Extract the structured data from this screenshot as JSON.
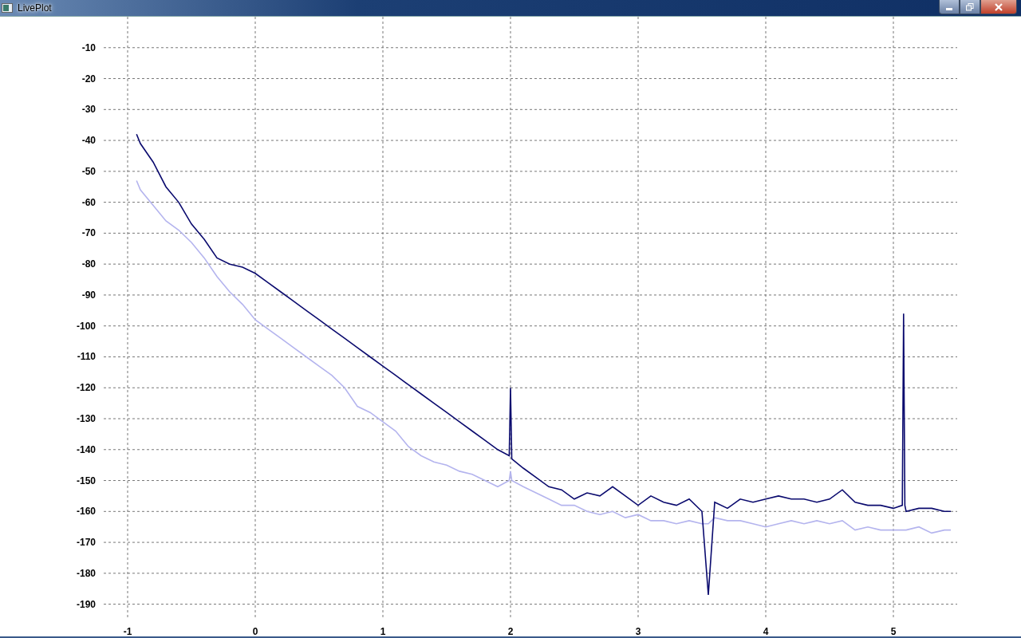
{
  "window": {
    "title": "LivePlot"
  },
  "plot": {
    "chart_data": {
      "type": "line",
      "x": [
        -0.93,
        -0.9,
        -0.8,
        -0.7,
        -0.6,
        -0.5,
        -0.4,
        -0.3,
        -0.2,
        -0.1,
        0,
        0.1,
        0.2,
        0.3,
        0.4,
        0.5,
        0.6,
        0.7,
        0.8,
        0.9,
        1.0,
        1.1,
        1.2,
        1.3,
        1.4,
        1.5,
        1.6,
        1.7,
        1.8,
        1.9,
        1.99,
        2.0,
        2.01,
        2.1,
        2.2,
        2.3,
        2.4,
        2.5,
        2.6,
        2.7,
        2.8,
        2.9,
        3.0,
        3.1,
        3.2,
        3.3,
        3.4,
        3.5,
        3.55,
        3.6,
        3.7,
        3.8,
        3.9,
        4.0,
        4.1,
        4.2,
        4.3,
        4.4,
        4.5,
        4.6,
        4.7,
        4.8,
        4.9,
        5.0,
        5.07,
        5.08,
        5.09,
        5.1,
        5.2,
        5.3,
        5.4,
        5.45
      ],
      "series": [
        {
          "color": "#0a0a6e",
          "values": [
            -38,
            -41,
            -47,
            -55,
            -60,
            -67,
            -72,
            -78,
            -80,
            -81,
            -83,
            -86,
            -89,
            -92,
            -95,
            -98,
            -101,
            -104,
            -107,
            -110,
            -113,
            -116,
            -119,
            -122,
            -125,
            -128,
            -131,
            -134,
            -137,
            -140,
            -142,
            -120,
            -143,
            -146,
            -149,
            -152,
            -153,
            -156,
            -154,
            -155,
            -152,
            -155,
            -158,
            -155,
            -157,
            -158,
            -156,
            -160,
            -187,
            -157,
            -159,
            -156,
            -157,
            -156,
            -155,
            -156,
            -156,
            -157,
            -156,
            -153,
            -157,
            -158,
            -158,
            -159,
            -158,
            -96,
            -158,
            -160,
            -159,
            -159,
            -160,
            -160
          ]
        },
        {
          "color": "#b4b4ee",
          "values": [
            -53,
            -56,
            -61,
            -66,
            -69,
            -73,
            -78,
            -84,
            -89,
            -93,
            -98,
            -101,
            -104,
            -107,
            -110,
            -113,
            -116,
            -120,
            -126,
            -128,
            -131,
            -134,
            -139,
            -142,
            -144,
            -145,
            -147,
            -148,
            -150,
            -152,
            -150,
            -147,
            -150,
            -152,
            -154,
            -156,
            -158,
            -158,
            -160,
            -161,
            -160,
            -162,
            -161,
            -163,
            -163,
            -164,
            -163,
            -164,
            -164,
            -162,
            -163,
            -163,
            -164,
            -165,
            -164,
            -163,
            -164,
            -163,
            -164,
            -163,
            -166,
            -165,
            -166,
            -166,
            -166,
            -166,
            -166,
            -166,
            -165,
            -167,
            -166,
            -166
          ]
        }
      ],
      "xlim": [
        -1.1875,
        5.5
      ],
      "ylim": [
        -195,
        0
      ],
      "grid": true,
      "xticks": [
        -1,
        0,
        1,
        2,
        3,
        4,
        5
      ],
      "yticks": [
        -10,
        -20,
        -30,
        -40,
        -50,
        -60,
        -70,
        -80,
        -90,
        -100,
        -110,
        -120,
        -130,
        -140,
        -150,
        -160,
        -170,
        -180,
        -190
      ]
    }
  }
}
